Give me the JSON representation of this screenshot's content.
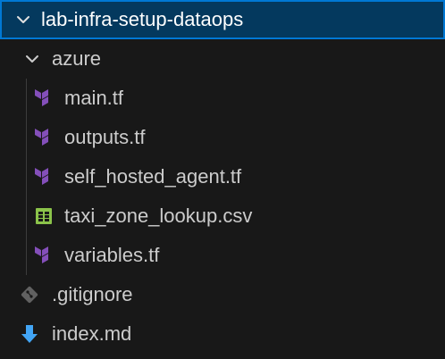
{
  "explorer": {
    "root": {
      "label": "lab-infra-setup-dataops",
      "icon": "chevron-down-icon"
    },
    "folder": {
      "label": "azure",
      "icon": "chevron-down-icon"
    },
    "files_in_folder": [
      {
        "label": "main.tf",
        "icon": "terraform-icon"
      },
      {
        "label": "outputs.tf",
        "icon": "terraform-icon"
      },
      {
        "label": "self_hosted_agent.tf",
        "icon": "terraform-icon"
      },
      {
        "label": "taxi_zone_lookup.csv",
        "icon": "csv-icon"
      },
      {
        "label": "variables.tf",
        "icon": "terraform-icon"
      }
    ],
    "root_files": [
      {
        "label": ".gitignore",
        "icon": "git-icon"
      },
      {
        "label": "index.md",
        "icon": "markdown-icon"
      }
    ]
  },
  "colors": {
    "background": "#181818",
    "selection_bg": "#04395e",
    "selection_border": "#0078d4",
    "terraform": "#844fba",
    "csv": "#8bc34a",
    "markdown": "#42a5f5",
    "git": "#616161"
  }
}
